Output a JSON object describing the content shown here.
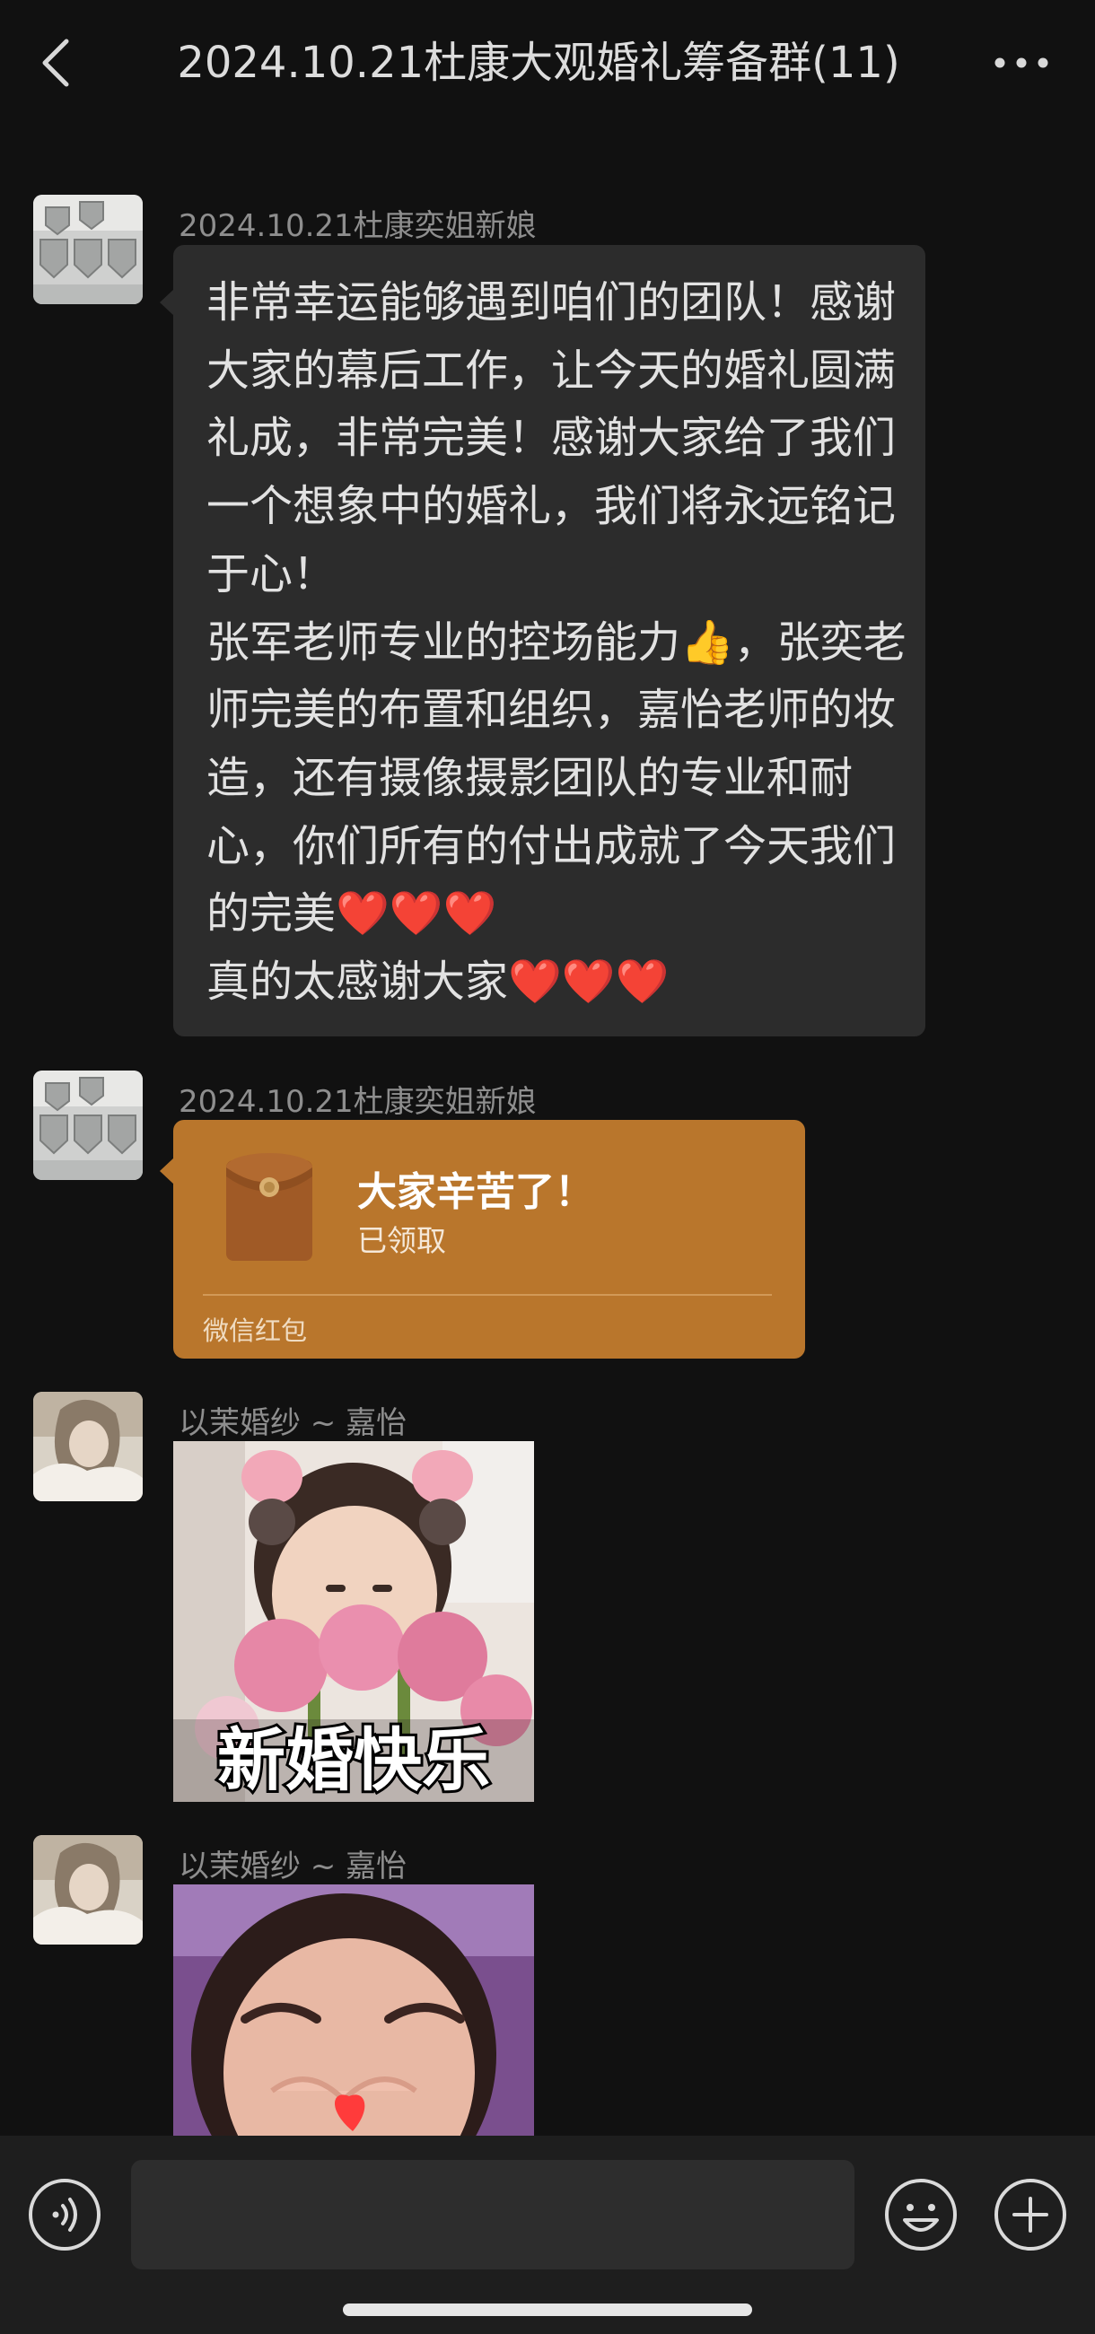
{
  "header": {
    "title": "2024.10.21杜康大观婚礼筹备群(11)",
    "back_icon": "chevron-left-icon",
    "more_icon": "more-dots-icon"
  },
  "messages": [
    {
      "sender": "2024.10.21杜康奕姐新娘",
      "type": "text",
      "text": "非常幸运能够遇到咱们的团队！感谢大家的幕后工作，让今天的婚礼圆满礼成，非常完美！感谢大家给了我们一个想象中的婚礼，我们将永远铭记于心！\n张军老师专业的控场能力👍，张奕老师完美的布置和组织，嘉怡老师的妆造，还有摄像摄影团队的专业和耐心，你们所有的付出成就了今天我们的完美❤️❤️❤️\n真的太感谢大家❤️❤️❤️"
    },
    {
      "sender": "2024.10.21杜康奕姐新娘",
      "type": "red_packet",
      "title": "大家辛苦了！",
      "status": "已领取",
      "label": "微信红包"
    },
    {
      "sender": "以茉婚纱 ~ 嘉怡",
      "type": "sticker",
      "caption": "新婚快乐"
    },
    {
      "sender": "以茉婚纱 ~ 嘉怡",
      "type": "sticker",
      "caption": ""
    }
  ],
  "input": {
    "placeholder": "",
    "value": ""
  },
  "bottom_icons": [
    "voice-icon",
    "emoji-icon",
    "plus-icon"
  ],
  "colors": {
    "background": "#111111",
    "bubble": "#2c2c2c",
    "red_packet": "#b9762c",
    "sender_text": "#8e8e8e"
  }
}
